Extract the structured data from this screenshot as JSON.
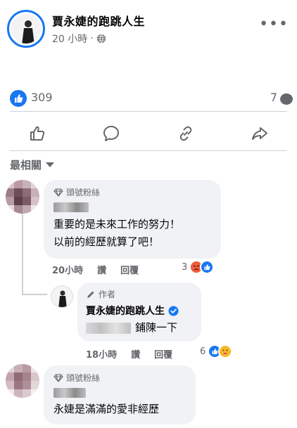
{
  "post": {
    "page_name": "賈永婕的跑跳人生",
    "time": "20 小時",
    "privacy_icon": "globe-icon",
    "more_icon": "more-dots-icon",
    "more_label": "•••"
  },
  "stats": {
    "like_count": "309",
    "comment_count": "7"
  },
  "actions": [
    {
      "icon": "like-icon"
    },
    {
      "icon": "comment-icon"
    },
    {
      "icon": "share-link-icon"
    },
    {
      "icon": "share-icon"
    }
  ],
  "sort": {
    "label": "最相關"
  },
  "comments": [
    {
      "badge": "頭號粉絲",
      "text_line1": "重要的是未來工作的努力！",
      "text_line2": "以前的經歷就算了吧！",
      "time": "20小時",
      "reply_action_1": "讚",
      "reply_action_2": "回覆",
      "reaction_count": "3",
      "reactions": [
        "angry",
        "like"
      ]
    },
    {
      "badge": "作者",
      "author": "賈永婕的跑跳人生",
      "text": "鋪陳一下",
      "time": "18小時",
      "reply_action_1": "讚",
      "reply_action_2": "回覆",
      "reaction_count": "6",
      "reactions": [
        "like",
        "care"
      ]
    },
    {
      "badge": "頭號粉絲",
      "text": "永婕是滿滿的愛非經歷"
    }
  ],
  "colors": {
    "accent": "#1877f2",
    "muted": "#65676b",
    "bubble": "#f0f2f5"
  }
}
